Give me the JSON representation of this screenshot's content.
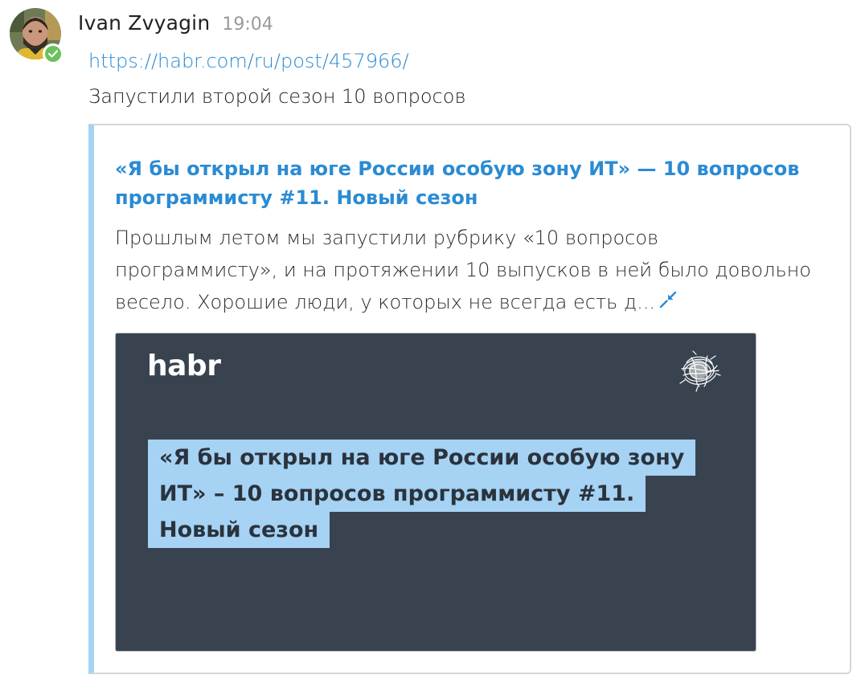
{
  "message": {
    "author": "Ivan Zvyagin",
    "time": "19:04",
    "link_text": "https://habr.com/ru/post/457966/",
    "caption": "Запустили второй сезон 10 вопросов",
    "avatar": "user-photo",
    "status_icon": "check-icon"
  },
  "preview": {
    "title": "«Я бы открыл на юге России особую зону ИТ» — 10 вопросов программисту #11. Новый сезон",
    "description": "Прошлым летом мы запустили рубрику «10 вопросов программисту», и на протяжении 10 выпусков в ней было довольно весело. Хорошие люди, у которых не всегда есть д...",
    "collapse_icon": "collapse-arrows-icon",
    "image": {
      "logo_text": "habr",
      "badge_icon": "scribble-ball-icon",
      "headline_lines": [
        "«Я бы открыл на юге России особую зону",
        "ИТ» – 10 вопросов программисту #11.",
        "Новый сезон"
      ]
    }
  },
  "colors": {
    "link": "#2a8bd3",
    "preview_bar": "#a6d2f3",
    "image_bg": "#38434f",
    "online": "#6ac15b"
  }
}
